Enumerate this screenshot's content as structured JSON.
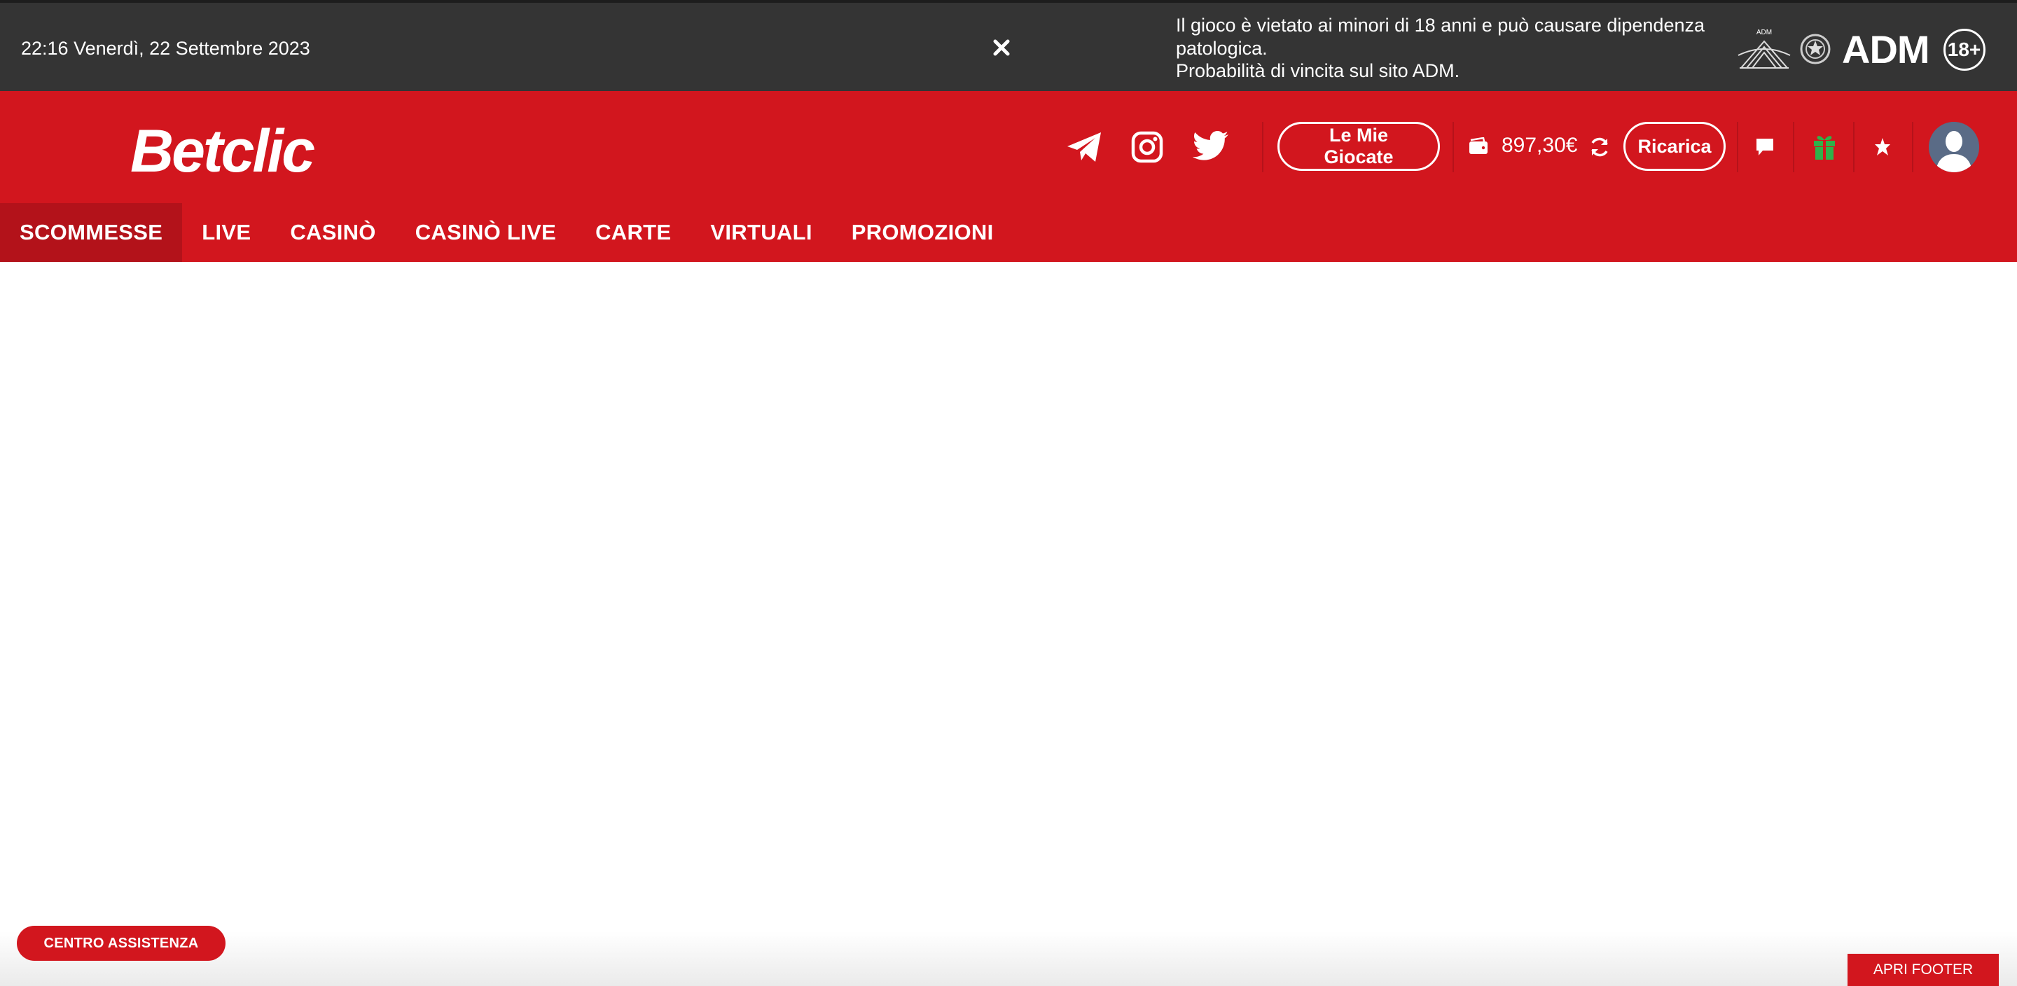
{
  "topbar": {
    "datetime": "22:16 Venerdì, 22 Settembre 2023",
    "close_icon": "close-icon",
    "warning_line1": "Il gioco è vietato ai minori di 18 anni e può causare dipendenza",
    "warning_line2": "patologica.",
    "warning_line3": "Probabilità di vincita sul sito ADM.",
    "adm_label": "ADM",
    "adm_small": "ADM",
    "age_badge": "18+"
  },
  "header": {
    "logo": "Betclic",
    "social": [
      "telegram-icon",
      "instagram-icon",
      "twitter-icon"
    ],
    "my_bets_label": "Le Mie Giocate",
    "balance": "897,30€",
    "recharge_label": "Ricarica",
    "icons": [
      "wallet-icon",
      "refresh-icon",
      "chat-icon",
      "gift-icon",
      "star-icon",
      "avatar"
    ]
  },
  "nav": {
    "items": [
      {
        "label": "SCOMMESSE",
        "active": true
      },
      {
        "label": "LIVE",
        "active": false
      },
      {
        "label": "CASINÒ",
        "active": false
      },
      {
        "label": "CASINÒ LIVE",
        "active": false
      },
      {
        "label": "CARTE",
        "active": false
      },
      {
        "label": "VIRTUALI",
        "active": false
      },
      {
        "label": "PROMOZIONI",
        "active": false
      }
    ]
  },
  "bottom": {
    "help_label": "CENTRO ASSISTENZA",
    "footer_label": "APRI FOOTER"
  },
  "colors": {
    "brand_red": "#d2161e",
    "nav_active": "#b3121a",
    "topbar_bg": "#343434",
    "gift_green": "#2fb24a"
  }
}
